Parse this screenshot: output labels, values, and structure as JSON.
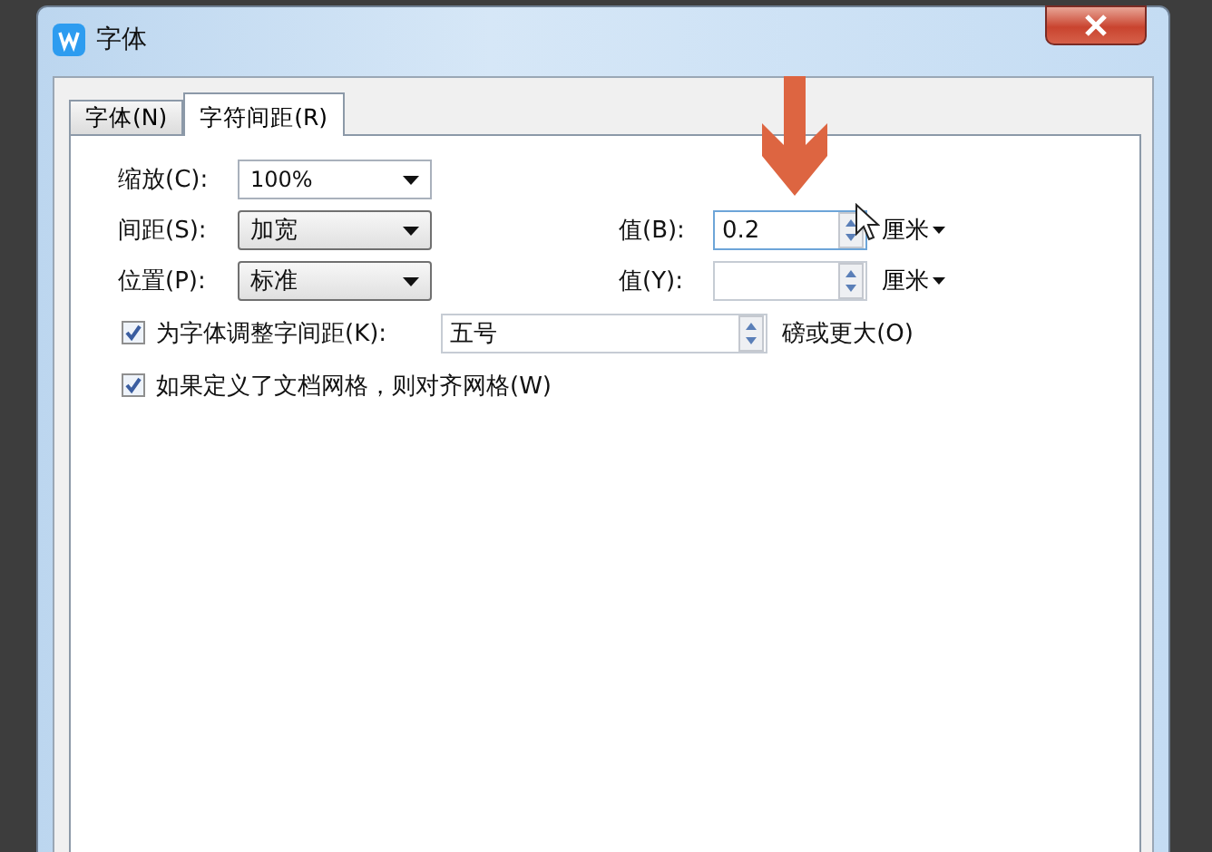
{
  "window": {
    "title": "字体"
  },
  "tabs": [
    {
      "label": "字体(N)",
      "selected": false
    },
    {
      "label": "字符间距(R)",
      "selected": true
    }
  ],
  "rows": [
    {
      "label": "缩放(C):",
      "combo": {
        "kind": "editable",
        "value": "100%"
      }
    },
    {
      "label": "间距(S):",
      "combo": {
        "kind": "list",
        "value": "加宽"
      },
      "spin": {
        "label": "值(B):",
        "value": "0.2",
        "focused": true,
        "unit": "厘米"
      }
    },
    {
      "label": "位置(P):",
      "combo": {
        "kind": "list",
        "value": "标准"
      },
      "spin": {
        "label": "值(Y):",
        "focused": false,
        "unit": "厘米"
      }
    }
  ],
  "options": [
    {
      "label": "为字体调整字间距(K):",
      "checked": true,
      "field": "五号",
      "suffix": "磅或更大(O)"
    },
    {
      "label": "如果定义了文档网格，则对齐网格(W)",
      "checked": true
    }
  ]
}
